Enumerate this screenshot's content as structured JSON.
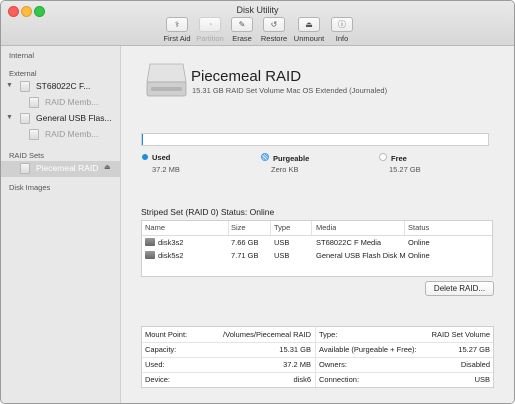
{
  "window": {
    "title": "Disk Utility"
  },
  "toolbar": {
    "first_aid": "First Aid",
    "partition": "Partition",
    "erase": "Erase",
    "restore": "Restore",
    "unmount": "Unmount",
    "info": "Info"
  },
  "sidebar": {
    "internal": "Internal",
    "external": "External",
    "raid_sets": "RAID Sets",
    "disk_images": "Disk Images",
    "items": [
      {
        "label": "ST68022C F..."
      },
      {
        "label": "RAID Memb..."
      },
      {
        "label": "General USB Flas..."
      },
      {
        "label": "RAID Memb..."
      },
      {
        "label": "Piecemeal RAID"
      }
    ]
  },
  "volume": {
    "name": "Piecemeal RAID",
    "description": "15.31 GB RAID Set Volume Mac OS Extended (Journaled)"
  },
  "usage": {
    "used_fraction": 0.0024,
    "used_label": "Used",
    "used_value": "37.2 MB",
    "purgeable_label": "Purgeable",
    "purgeable_value": "Zero KB",
    "free_label": "Free",
    "free_value": "15.27 GB",
    "used_color": "#1a8fe0"
  },
  "raid": {
    "status": "Striped Set (RAID 0) Status: Online",
    "columns": [
      "Name",
      "Size",
      "Type",
      "Media",
      "Status"
    ],
    "rows": [
      [
        "disk3s2",
        "7.66 GB",
        "USB",
        "ST68022C F Media",
        "Online"
      ],
      [
        "disk5s2",
        "7.71 GB",
        "USB",
        "General USB Flash Disk Me",
        "Online"
      ]
    ],
    "delete_button": "Delete RAID..."
  },
  "info": {
    "left": [
      {
        "label": "Mount Point:",
        "value": "/Volumes/Piecemeal RAID"
      },
      {
        "label": "Capacity:",
        "value": "15.31 GB"
      },
      {
        "label": "Used:",
        "value": "37.2 MB"
      },
      {
        "label": "Device:",
        "value": "disk6"
      }
    ],
    "right": [
      {
        "label": "Type:",
        "value": "RAID Set Volume"
      },
      {
        "label": "Available (Purgeable + Free):",
        "value": "15.27 GB"
      },
      {
        "label": "Owners:",
        "value": "Disabled"
      },
      {
        "label": "Connection:",
        "value": "USB"
      }
    ]
  }
}
